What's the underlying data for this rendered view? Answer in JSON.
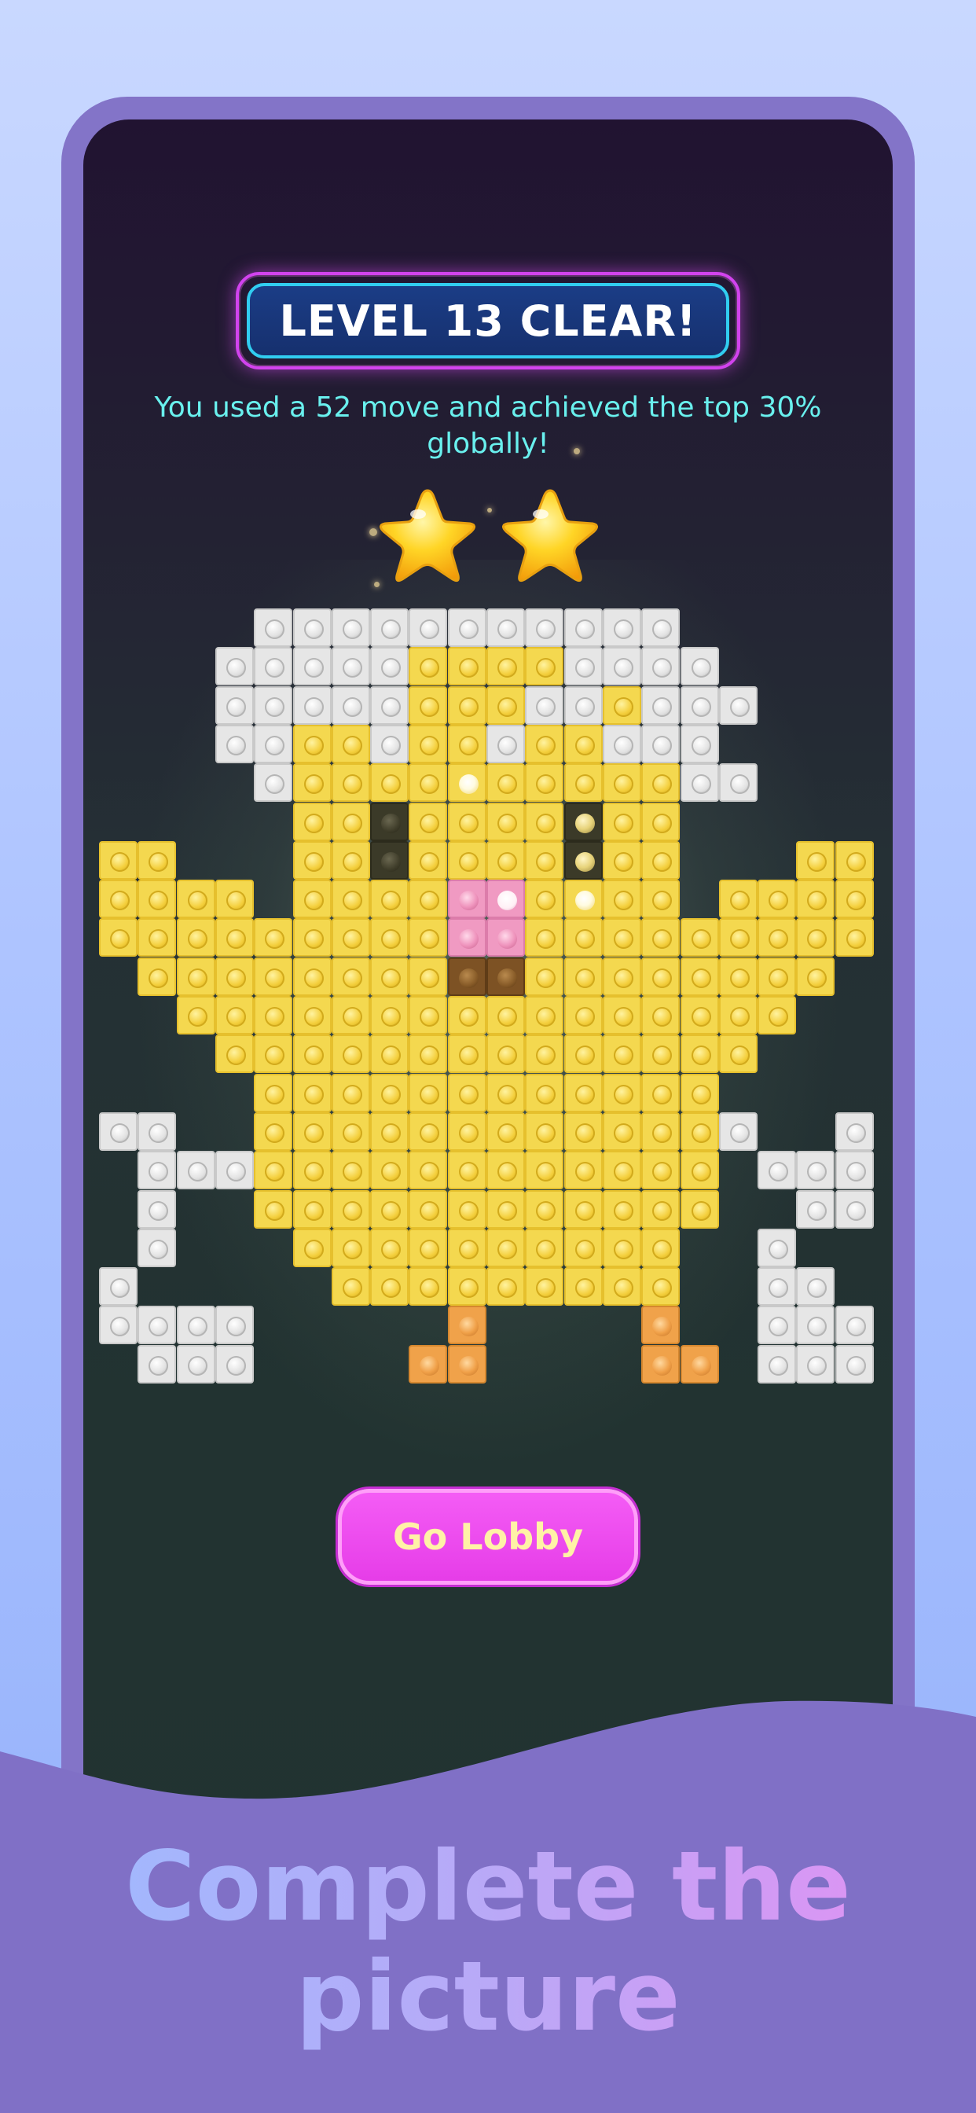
{
  "level_banner": {
    "title": "LEVEL 13 CLEAR!"
  },
  "result_message": "You used a 52 move and achieved the top 30% globally!",
  "stars": {
    "earned": 2
  },
  "buttons": {
    "go_lobby": "Go Lobby"
  },
  "caption": {
    "line1": "Complete the",
    "line2": "picture"
  },
  "colors": {
    "banner_border": "#d243ee",
    "banner_inner_border": "#31cdf0",
    "banner_fill": "#1b3d86",
    "message_text": "#69f0ee",
    "button_fill": "#e63de8",
    "button_text": "#fff2a6",
    "frame": "#8374c8",
    "wave": "#8070c6"
  },
  "pixel_art": {
    "legend": {
      "Y": "yellow",
      "W": "white",
      "P": "pink",
      "B": "brown",
      "O": "orange",
      "E": "eye-dark",
      "G": "eye-glint",
      "S": "highlight",
      "Q": "pink-highlight"
    },
    "rows": [
      "....WWWWWWWWWWW.....",
      "...WWWWWYYYYWWWW....",
      "...WWWWWYYYWWYWWW...",
      "...WWYYWYYWYYWWW....",
      "....WYYYYSYYYYYWW...",
      ".....YYEYYYYGYY.....",
      "YY...YYEYYYYGYY...YY",
      "YYYY.YYYYPQYSYY.YYYY",
      "YYYYYYYYYPPYYYYYYYYY",
      ".YYYYYYYYBBYYYYYYYY.",
      "..YYYYYYYYYYYYYYYY..",
      "...YYYYYYYYYYYYYY...",
      "....YYYYYYYYYYYY....",
      "WW..YYYYYYYYYYYYW..W",
      ".WWWYYYYYYYYYYYY.WWW",
      ".W..YYYYYYYYYYYY..WW",
      ".W...YYYYYYYYYY..W..",
      "W.....YYYYYYYYY..WW.",
      "WWWW.....O....O..WWW",
      ".WWW....OO....OO.WWW"
    ]
  }
}
